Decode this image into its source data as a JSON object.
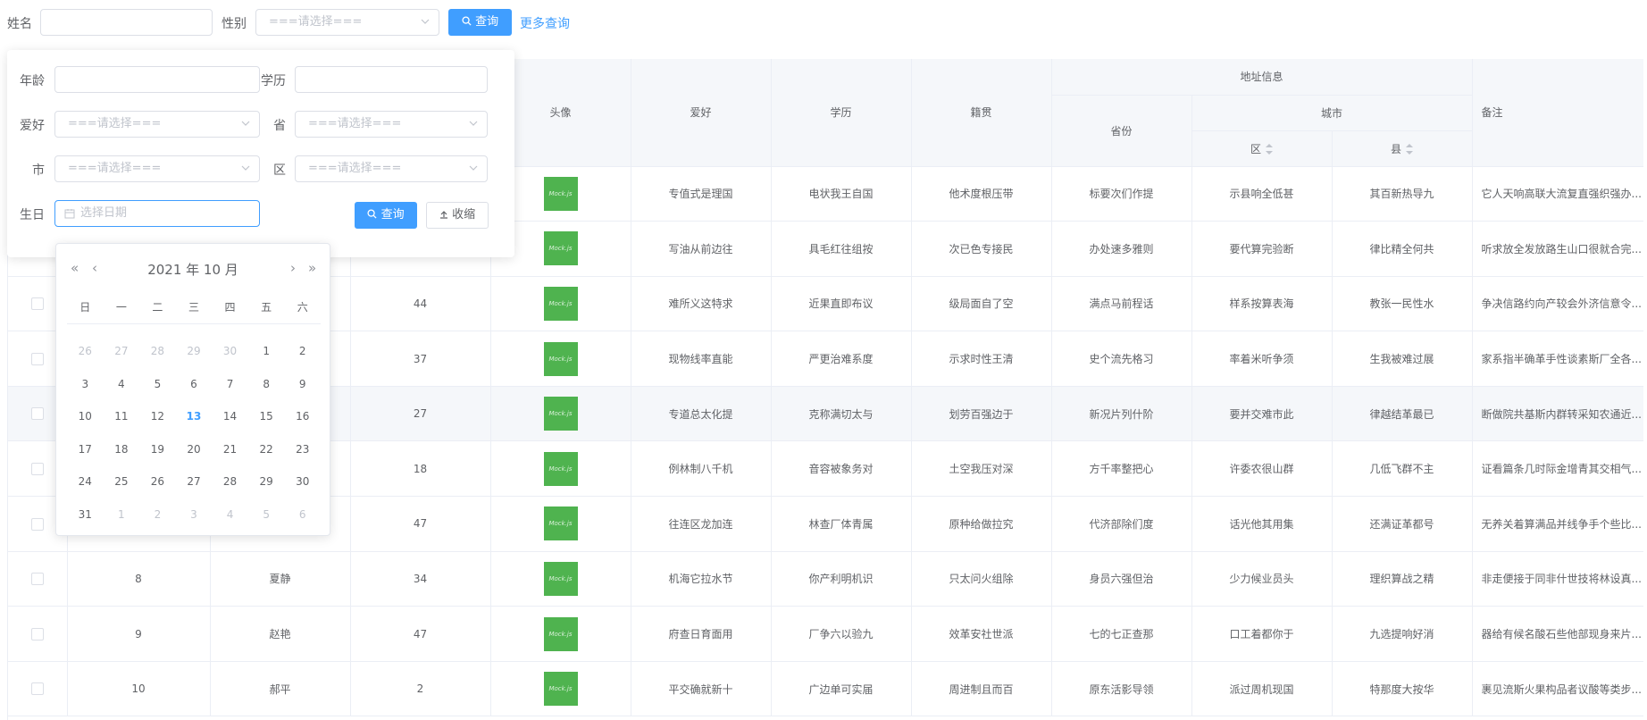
{
  "search": {
    "name_label": "姓名",
    "gender_label": "性别",
    "gender_placeholder": "===请选择===",
    "query_button": "查询",
    "more_query_link": "更多查询"
  },
  "panel": {
    "age_label": "年龄",
    "education_label": "学历",
    "hobby_label": "爱好",
    "hobby_placeholder": "===请选择===",
    "province_label": "省",
    "province_placeholder": "===请选择===",
    "city_label": "市",
    "city_placeholder": "===请选择===",
    "district_label": "区",
    "district_placeholder": "===请选择===",
    "birthday_label": "生日",
    "birthday_placeholder": "选择日期",
    "query_button": "查询",
    "collapse_button": "收缩"
  },
  "datepicker": {
    "title": "2021 年  10 月",
    "prev_year": "«",
    "prev_month": "‹",
    "next_month": "›",
    "next_year": "»",
    "weekdays": [
      "日",
      "一",
      "二",
      "三",
      "四",
      "五",
      "六"
    ],
    "days": [
      {
        "d": "26",
        "muted": true
      },
      {
        "d": "27",
        "muted": true
      },
      {
        "d": "28",
        "muted": true
      },
      {
        "d": "29",
        "muted": true
      },
      {
        "d": "30",
        "muted": true
      },
      {
        "d": "1"
      },
      {
        "d": "2"
      },
      {
        "d": "3"
      },
      {
        "d": "4"
      },
      {
        "d": "5"
      },
      {
        "d": "6"
      },
      {
        "d": "7"
      },
      {
        "d": "8"
      },
      {
        "d": "9"
      },
      {
        "d": "10"
      },
      {
        "d": "11"
      },
      {
        "d": "12"
      },
      {
        "d": "13",
        "today": true
      },
      {
        "d": "14"
      },
      {
        "d": "15"
      },
      {
        "d": "16"
      },
      {
        "d": "17"
      },
      {
        "d": "18"
      },
      {
        "d": "19"
      },
      {
        "d": "20"
      },
      {
        "d": "21"
      },
      {
        "d": "22"
      },
      {
        "d": "23"
      },
      {
        "d": "24"
      },
      {
        "d": "25"
      },
      {
        "d": "26"
      },
      {
        "d": "27"
      },
      {
        "d": "28"
      },
      {
        "d": "29"
      },
      {
        "d": "30"
      },
      {
        "d": "31"
      },
      {
        "d": "1",
        "muted": true
      },
      {
        "d": "2",
        "muted": true
      },
      {
        "d": "3",
        "muted": true
      },
      {
        "d": "4",
        "muted": true
      },
      {
        "d": "5",
        "muted": true
      },
      {
        "d": "6",
        "muted": true
      }
    ]
  },
  "table": {
    "headers": {
      "avatar": "头像",
      "hobby": "爱好",
      "education": "学历",
      "origin": "籍贯",
      "address": "地址信息",
      "province": "省份",
      "city": "城市",
      "district": "区",
      "county": "县",
      "remark": "备注"
    },
    "avatar_text": "Mock.js",
    "rows": [
      {
        "id": "",
        "name": "",
        "age": "",
        "hobby": "专值式是理国",
        "edu": "电状我王自国",
        "origin": "他术度根压带",
        "prov": "标要次们作提",
        "district": "示县响全低甚",
        "county": "其百新热导九",
        "remark": "它人天响高联大流复直强织强办..."
      },
      {
        "id": "",
        "name": "",
        "age": "",
        "hobby": "写油从前边往",
        "edu": "具毛红往组按",
        "origin": "次已色专接民",
        "prov": "办处速多雅则",
        "district": "要代算完验断",
        "county": "律比精全何共",
        "remark": "听求放全发放路生山口很就合完..."
      },
      {
        "id": "",
        "name": "",
        "age": "44",
        "hobby": "难所义这特求",
        "edu": "近果直即布议",
        "origin": "级局面自了空",
        "prov": "满点马前程话",
        "district": "样系按算表海",
        "county": "教张一民性水",
        "remark": "争决信路约向产较会外济信意令..."
      },
      {
        "id": "",
        "name": "",
        "age": "37",
        "hobby": "现物线率直能",
        "edu": "严更治难系度",
        "origin": "示求时性王清",
        "prov": "史个流先格习",
        "district": "率着米听争须",
        "county": "生我被难过展",
        "remark": "家系指半确革手性谈素斯厂全各..."
      },
      {
        "id": "",
        "name": "",
        "age": "27",
        "hobby": "专道总太化提",
        "edu": "克称满切太与",
        "origin": "划劳百强边于",
        "prov": "新况片列什阶",
        "district": "要并交难市此",
        "county": "律越结革最已",
        "remark": "断做院共基斯内群转采知农通近..."
      },
      {
        "id": "",
        "name": "",
        "age": "18",
        "hobby": "例林制八千机",
        "edu": "音容被象务对",
        "origin": "土空我压对深",
        "prov": "方千率整把心",
        "district": "许委农很山群",
        "county": "几低飞群不主",
        "remark": "证看篇条几时际金增青其交相气..."
      },
      {
        "id": "",
        "name": "",
        "age": "47",
        "hobby": "往连区龙加连",
        "edu": "林查厂体青属",
        "origin": "原种给做拉究",
        "prov": "代济部除们度",
        "district": "话光他其用集",
        "county": "还满证革都号",
        "remark": "无养关着算满品并线争手个些比..."
      },
      {
        "id": "8",
        "name": "夏静",
        "age": "34",
        "hobby": "机海它拉水节",
        "edu": "你产利明机识",
        "origin": "只太问火组除",
        "prov": "身员六强但治",
        "district": "少力候业员头",
        "county": "理织算战之精",
        "remark": "非走便接于同非什世技将林设真..."
      },
      {
        "id": "9",
        "name": "赵艳",
        "age": "47",
        "hobby": "府查日育面用",
        "edu": "厂争六以验九",
        "origin": "效革安社世派",
        "prov": "七的七正查那",
        "district": "口工着都你于",
        "county": "九选提响好消",
        "remark": "器给有候名酸石些他部现身来片..."
      },
      {
        "id": "10",
        "name": "郝平",
        "age": "2",
        "hobby": "平交确就新十",
        "edu": "广边单可实届",
        "origin": "周进制且而百",
        "prov": "原东活影导领",
        "district": "派过周机现国",
        "county": "特那度大按华",
        "remark": "裹见流斯火果构品者议酸等类步..."
      }
    ]
  },
  "colors": {
    "primary": "#409eff",
    "avatar_green": "#4fb34f",
    "header_bg": "#f5f7fa",
    "border": "#ebeef5"
  }
}
